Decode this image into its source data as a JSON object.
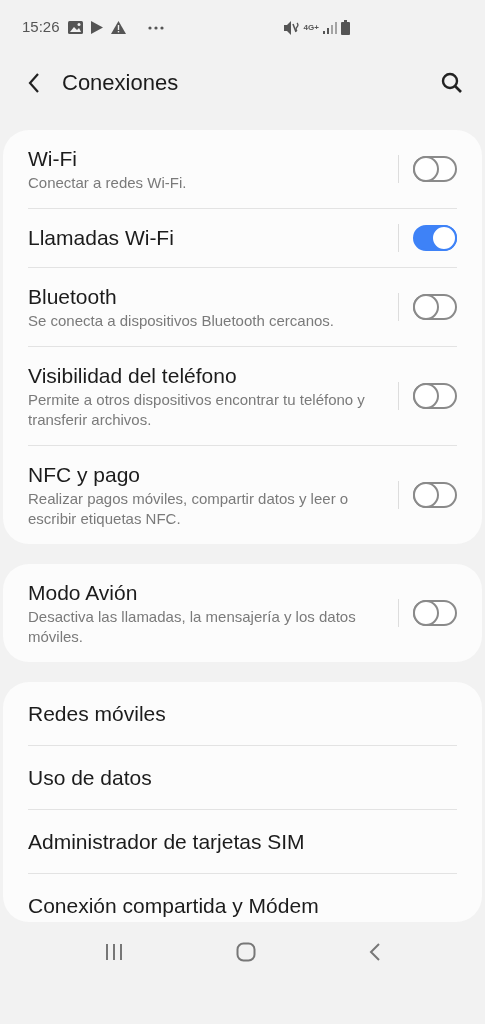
{
  "status_bar": {
    "time": "15:26",
    "network": "4G+"
  },
  "header": {
    "title": "Conexiones"
  },
  "groups": [
    {
      "items": [
        {
          "kind": "toggle",
          "title": "Wi-Fi",
          "subtitle": "Conectar a redes Wi-Fi.",
          "on": false
        },
        {
          "kind": "toggle",
          "title": "Llamadas Wi-Fi",
          "on": true
        },
        {
          "kind": "toggle",
          "title": "Bluetooth",
          "subtitle": "Se conecta a dispositivos Bluetooth cercanos.",
          "on": false
        },
        {
          "kind": "toggle",
          "title": "Visibilidad del teléfono",
          "subtitle": "Permite a otros dispositivos encontrar tu teléfono y transferir archivos.",
          "on": false
        },
        {
          "kind": "toggle",
          "title": "NFC y pago",
          "subtitle": "Realizar pagos móviles, compartir datos y leer o escribir etiquetas NFC.",
          "on": false
        }
      ]
    },
    {
      "items": [
        {
          "kind": "toggle",
          "title": "Modo Avión",
          "subtitle": "Desactiva las llamadas, la mensajería y los datos móviles.",
          "on": false
        }
      ]
    },
    {
      "items": [
        {
          "kind": "link",
          "title": "Redes móviles"
        },
        {
          "kind": "link",
          "title": "Uso de datos"
        },
        {
          "kind": "link",
          "title": "Administrador de tarjetas SIM"
        },
        {
          "kind": "link",
          "title": "Conexión compartida y Módem"
        }
      ]
    }
  ]
}
